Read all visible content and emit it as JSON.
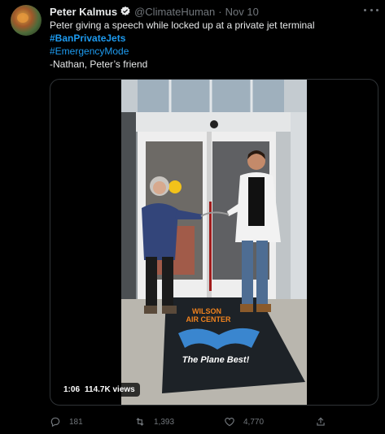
{
  "tweet": {
    "author_name": "Peter Kalmus",
    "handle": "@ClimateHuman",
    "separator": "·",
    "date": "Nov 10",
    "text_line1": "Peter giving a speech while locked up at a private jet terminal",
    "hashtag1": "#BanPrivateJets",
    "hashtag2": "#EmergencyMode",
    "signature": "-Nathan, Peter’s friend"
  },
  "video": {
    "duration": "1:06",
    "views": "114.7K views",
    "rug_line1": "WILSON",
    "rug_line2": "AIR CENTER",
    "rug_slogan": "The Plane Best!"
  },
  "actions": {
    "replies": "181",
    "retweets": "1,393",
    "likes": "4,770"
  },
  "colors": {
    "background": "#000000",
    "text": "#e7e9ea",
    "secondary": "#71767b",
    "accent": "#1d9bf0",
    "border": "#2f3336"
  }
}
